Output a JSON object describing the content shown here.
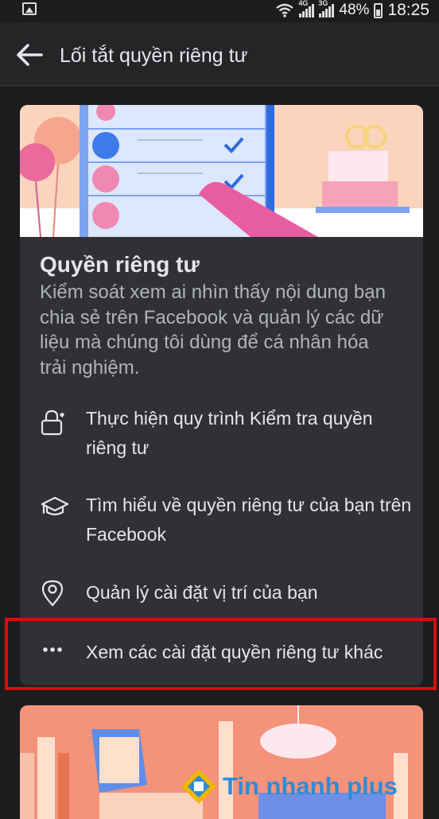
{
  "status_bar": {
    "network_1": "4G",
    "network_2": "3G",
    "battery": "48%",
    "time": "18:25"
  },
  "header": {
    "title": "Lối tắt quyền riêng tư"
  },
  "privacy_card": {
    "title": "Quyền riêng tư",
    "description": "Kiểm soát xem ai nhìn thấy nội dung bạn chia sẻ trên Facebook và quản lý các dữ liệu mà chúng tôi dùng để cá nhân hóa trải nghiệm.",
    "options": [
      {
        "label": "Thực hiện quy trình Kiểm tra quyền riêng tư",
        "icon": "lock-heart-icon"
      },
      {
        "label": "Tìm hiểu về quyền riêng tư của bạn trên Facebook",
        "icon": "graduation-cap-icon"
      },
      {
        "label": "Quản lý cài đặt vị trí của bạn",
        "icon": "location-pin-icon"
      },
      {
        "label": "Xem các cài đặt quyền riêng tư khác",
        "icon": "more-dots-icon"
      }
    ]
  },
  "watermark": {
    "text": "Tin nhanh plus"
  },
  "colors": {
    "background": "#1c1c1e",
    "card": "#303134",
    "highlight": "#d01010",
    "banner": "#fbd4bd"
  }
}
